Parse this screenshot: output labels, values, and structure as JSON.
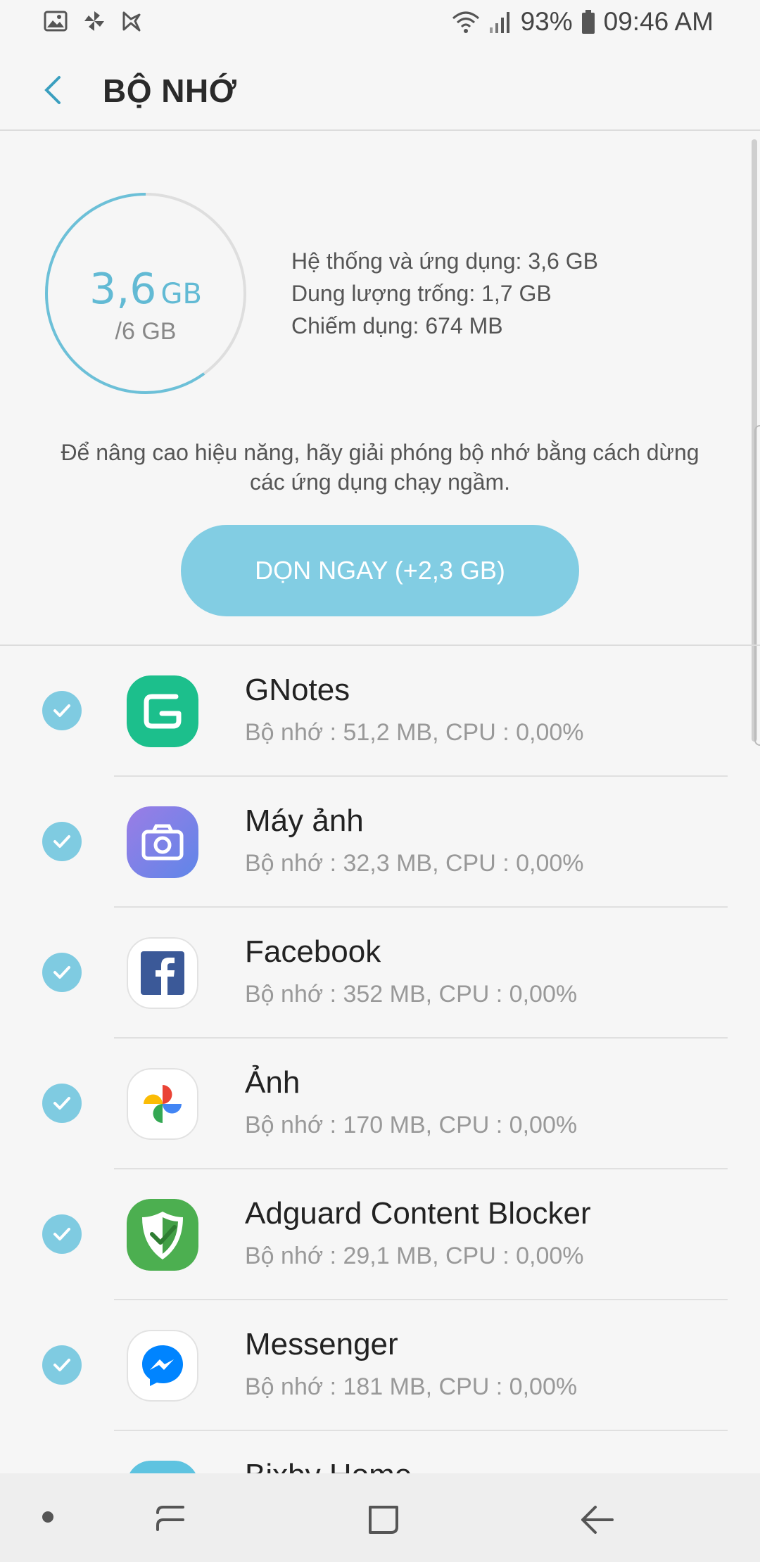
{
  "status_bar": {
    "battery": "93%",
    "time": "09:46 AM"
  },
  "header": {
    "title": "BỘ NHỚ"
  },
  "memory": {
    "used_value": "3,6",
    "used_unit": "GB",
    "total": "/6 GB",
    "used_fraction": 0.6,
    "details": [
      "Hệ thống và ứng dụng: 3,6 GB",
      "Dung lượng trống: 1,7 GB",
      "Chiếm dụng: 674 MB"
    ],
    "hint_line1": "Để nâng cao hiệu năng, hãy giải phóng bộ nhớ bằng cách dừng",
    "hint_line2": "các ứng dụng chạy ngầm.",
    "clean_button": "DỌN NGAY (+2,3 GB)"
  },
  "apps": [
    {
      "name": "GNotes",
      "info": "Bộ nhớ : 51,2 MB, CPU : 0,00%",
      "icon": "gnotes-icon",
      "checked": true
    },
    {
      "name": "Máy ảnh",
      "info": "Bộ nhớ : 32,3 MB, CPU : 0,00%",
      "icon": "camera-icon",
      "checked": true
    },
    {
      "name": "Facebook",
      "info": "Bộ nhớ : 352 MB, CPU : 0,00%",
      "icon": "facebook-icon",
      "checked": true
    },
    {
      "name": "Ảnh",
      "info": "Bộ nhớ : 170 MB, CPU : 0,00%",
      "icon": "photos-icon",
      "checked": true
    },
    {
      "name": "Adguard Content Blocker",
      "info": "Bộ nhớ : 29,1 MB, CPU : 0,00%",
      "icon": "adguard-icon",
      "checked": true
    },
    {
      "name": "Messenger",
      "info": "Bộ nhớ : 181 MB, CPU : 0,00%",
      "icon": "messenger-icon",
      "checked": true
    },
    {
      "name": "Bixby Home",
      "info": "",
      "icon": "bixby-icon",
      "checked": true
    }
  ],
  "colors": {
    "accent": "#62bad4",
    "button": "#82cde3",
    "check": "#7fcbe1"
  }
}
